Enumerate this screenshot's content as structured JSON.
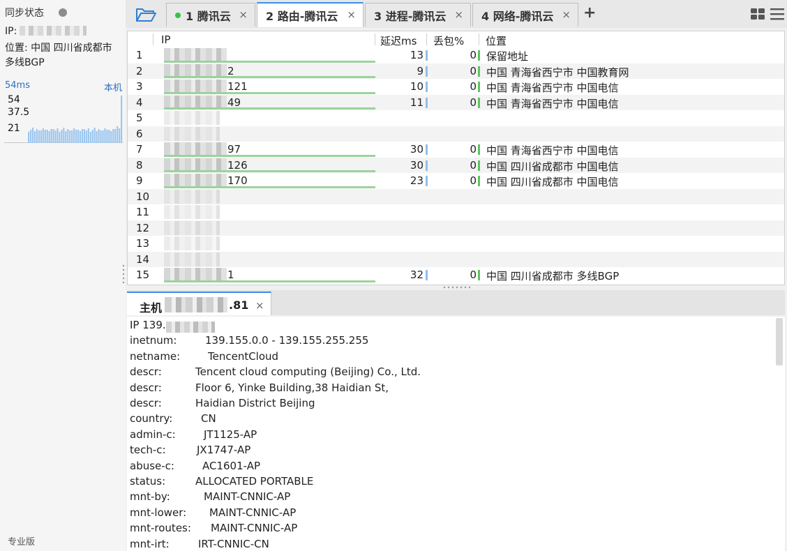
{
  "sidebar": {
    "sync_status": "同步状态",
    "ip_label": "IP:",
    "location": "位置: 中国 四川省成都市 多线BGP",
    "ping": "54ms",
    "ping_target": "本机",
    "spark_labels": [
      "54",
      "37.5",
      "21"
    ],
    "edition": "专业版"
  },
  "tabs": [
    {
      "label": "1 腾讯云"
    },
    {
      "label": "2 路由-腾讯云"
    },
    {
      "label": "3 进程-腾讯云"
    },
    {
      "label": "4 网络-腾讯云"
    }
  ],
  "tab_add": "+",
  "table": {
    "headers": {
      "ip": "IP",
      "latency": "延迟ms",
      "loss": "丢包%",
      "location": "位置"
    },
    "rows": [
      {
        "n": "1",
        "ip_suffix": "",
        "latency": "13",
        "loss": "0",
        "loc": "保留地址"
      },
      {
        "n": "2",
        "ip_suffix": "2",
        "latency": "9",
        "loss": "0",
        "loc": "中国 青海省西宁市 中国教育网"
      },
      {
        "n": "3",
        "ip_suffix": "121",
        "latency": "10",
        "loss": "0",
        "loc": "中国 青海省西宁市 中国电信"
      },
      {
        "n": "4",
        "ip_suffix": "49",
        "latency": "11",
        "loss": "0",
        "loc": "中国 青海省西宁市 中国电信"
      },
      {
        "n": "5",
        "ip_suffix": "",
        "latency": "",
        "loss": "",
        "loc": ""
      },
      {
        "n": "6",
        "ip_suffix": "",
        "latency": "",
        "loss": "",
        "loc": ""
      },
      {
        "n": "7",
        "ip_suffix": "97",
        "latency": "30",
        "loss": "0",
        "loc": "中国 青海省西宁市 中国电信"
      },
      {
        "n": "8",
        "ip_suffix": "126",
        "latency": "30",
        "loss": "0",
        "loc": "中国 四川省成都市 中国电信"
      },
      {
        "n": "9",
        "ip_suffix": "170",
        "latency": "23",
        "loss": "0",
        "loc": "中国 四川省成都市 中国电信"
      },
      {
        "n": "10",
        "ip_suffix": "",
        "latency": "",
        "loss": "",
        "loc": ""
      },
      {
        "n": "11",
        "ip_suffix": "",
        "latency": "",
        "loss": "",
        "loc": ""
      },
      {
        "n": "12",
        "ip_suffix": "",
        "latency": "",
        "loss": "",
        "loc": ""
      },
      {
        "n": "13",
        "ip_suffix": "",
        "latency": "",
        "loss": "",
        "loc": ""
      },
      {
        "n": "14",
        "ip_suffix": "",
        "latency": "",
        "loss": "",
        "loc": ""
      },
      {
        "n": "15",
        "ip_suffix": "1",
        "latency": "32",
        "loss": "0",
        "loc": "中国 四川省成都市 多线BGP"
      }
    ]
  },
  "host_tab": {
    "prefix": "主机",
    "suffix": ".81",
    "close": "×"
  },
  "whois": [
    {
      "k": "IP 139.",
      "v": ""
    },
    {
      "k": "inetnum:",
      "v": "139.155.0.0 - 139.155.255.255"
    },
    {
      "k": "netname:",
      "v": "TencentCloud"
    },
    {
      "k": "descr:",
      "v": "Tencent cloud computing (Beijing) Co., Ltd."
    },
    {
      "k": "descr:",
      "v": "Floor 6, Yinke Building,38 Haidian St,"
    },
    {
      "k": "descr:",
      "v": "Haidian District Beijing"
    },
    {
      "k": "country:",
      "v": "CN"
    },
    {
      "k": "admin-c:",
      "v": "JT1125-AP"
    },
    {
      "k": "tech-c:",
      "v": "JX1747-AP"
    },
    {
      "k": "abuse-c:",
      "v": "AC1601-AP"
    },
    {
      "k": "status:",
      "v": "ALLOCATED PORTABLE"
    },
    {
      "k": "mnt-by:",
      "v": "MAINT-CNNIC-AP"
    },
    {
      "k": "mnt-lower:",
      "v": "MAINT-CNNIC-AP"
    },
    {
      "k": "mnt-routes:",
      "v": "MAINT-CNNIC-AP"
    },
    {
      "k": "mnt-irt:",
      "v": "IRT-CNNIC-CN"
    }
  ]
}
